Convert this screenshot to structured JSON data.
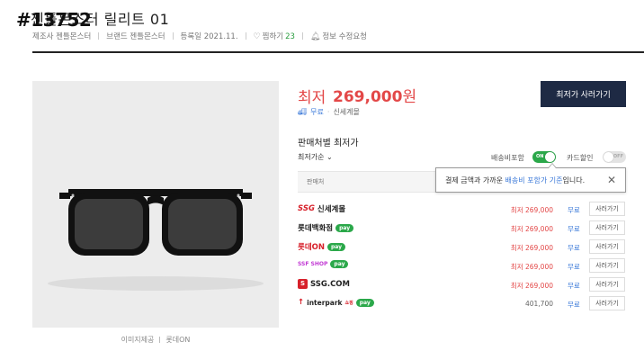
{
  "overlay_id": "#13752",
  "product": {
    "title": "젠틀몬스터 릴리트 01",
    "maker": "제조사 젠틀몬스터",
    "brand": "브랜드 젠틀몬스터",
    "registered": "등록일 2021.11.",
    "wish_label": "찜하기",
    "wish_count": "23",
    "report_label": "정보 수정요청"
  },
  "image": {
    "provider": "이미지제공",
    "provider_name": "롯데ON"
  },
  "price": {
    "lowest_label": "최저",
    "lowest_value": "269,000",
    "currency": "원",
    "buy_button": "최저가 사러가기",
    "free_ship": "무료",
    "dot": "·",
    "mall": "신세계몰"
  },
  "sellers": {
    "title": "판매처별 최저가",
    "sort_label": "최저가순",
    "ship_incl_label": "배송비포함",
    "ship_incl_state": "ON",
    "card_disc_label": "카드할인",
    "card_disc_state": "OFF",
    "column_seller": "판매처",
    "tooltip": {
      "text_before": "결제 금액과 가까운 ",
      "text_highlight": "배송비 포함가 기준",
      "text_after": "입니다.",
      "close": "✕"
    },
    "rows": [
      {
        "mall": "신세계몰",
        "badge": "SSG",
        "pay": "",
        "price": "최저 269,000",
        "ship": "무료",
        "buy": "사러가기"
      },
      {
        "mall": "롯데백화점",
        "badge": "",
        "pay": "pay",
        "price": "최저 269,000",
        "ship": "무료",
        "buy": "사러가기"
      },
      {
        "mall": "롯데ON",
        "badge": "",
        "pay": "pay",
        "price": "최저 269,000",
        "ship": "무료",
        "buy": "사러가기"
      },
      {
        "mall": "SSF SHOP",
        "badge": "",
        "pay": "pay",
        "price": "최저 269,000",
        "ship": "무료",
        "buy": "사러가기"
      },
      {
        "mall": "SSG.COM",
        "badge": "S",
        "pay": "",
        "price": "최저 269,000",
        "ship": "무료",
        "buy": "사러가기"
      },
      {
        "mall": "interpark",
        "badge": "쇼핑",
        "pay": "pay",
        "price": "401,700",
        "ship": "무료",
        "buy": "사러가기"
      }
    ]
  },
  "colors": {
    "accent_red": "#e34848",
    "navy": "#1e2a44",
    "naver_green": "#2ba84a",
    "link_blue": "#3a78d8"
  }
}
